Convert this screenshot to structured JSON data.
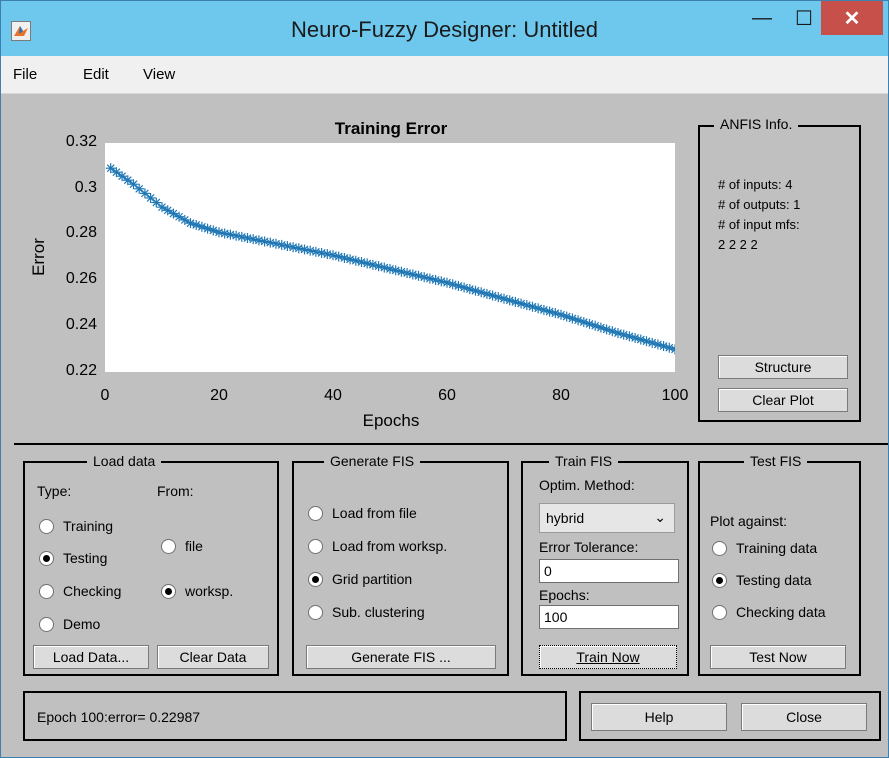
{
  "window": {
    "title": "Neuro-Fuzzy Designer: Untitled"
  },
  "titlebar": {
    "minimize_glyph": "—",
    "maximize_glyph": "☐",
    "close_glyph": "✕"
  },
  "menu": {
    "file": "File",
    "edit": "Edit",
    "view": "View"
  },
  "chart": {
    "chart_data": {
      "type": "line",
      "title": "Training Error",
      "xlabel": "Epochs",
      "ylabel": "Error",
      "xlim": [
        0,
        100
      ],
      "ylim": [
        0.22,
        0.32
      ],
      "xticks": [
        "0",
        "20",
        "40",
        "60",
        "80",
        "100"
      ],
      "yticks": [
        "0.32",
        "0.3",
        "0.28",
        "0.26",
        "0.24",
        "0.22"
      ],
      "marker": "asterisk",
      "color": "#1f77b4",
      "series": [
        {
          "x": [
            1,
            5,
            10,
            15,
            20,
            30,
            40,
            50,
            60,
            70,
            80,
            90,
            100
          ],
          "y": [
            0.309,
            0.302,
            0.292,
            0.285,
            0.281,
            0.276,
            0.271,
            0.265,
            0.259,
            0.252,
            0.245,
            0.237,
            0.2299
          ]
        }
      ]
    }
  },
  "anfis_info": {
    "title": "ANFIS Info.",
    "inputs": "# of inputs: 4",
    "outputs": "# of outputs: 1",
    "input_mfs": "# of input mfs:",
    "mfs_values": "2 2 2 2",
    "structure_btn": "Structure",
    "clear_plot_btn": "Clear Plot"
  },
  "load_data": {
    "title": "Load data",
    "type_label": "Type:",
    "from_label": "From:",
    "type_options": [
      "Training",
      "Testing",
      "Checking",
      "Demo"
    ],
    "type_selected": "Testing",
    "from_options": [
      "file",
      "worksp."
    ],
    "from_selected": "worksp.",
    "load_btn": "Load Data...",
    "clear_btn": "Clear Data"
  },
  "generate_fis": {
    "title": "Generate FIS",
    "options": [
      "Load from file",
      "Load from worksp.",
      "Grid partition",
      "Sub. clustering"
    ],
    "selected": "Grid partition",
    "button": "Generate FIS ..."
  },
  "train_fis": {
    "title": "Train FIS",
    "optim_label": "Optim. Method:",
    "method": "hybrid",
    "tolerance_label": "Error Tolerance:",
    "tolerance": "0",
    "epochs_label": "Epochs:",
    "epochs": "100",
    "button": "Train Now"
  },
  "test_fis": {
    "title": "Test FIS",
    "plot_against": "Plot against:",
    "options": [
      "Training data",
      "Testing data",
      "Checking data"
    ],
    "selected": "Testing data",
    "button": "Test Now"
  },
  "status": {
    "text": "Epoch 100:error= 0.22987"
  },
  "footer": {
    "help": "Help",
    "close": "Close"
  }
}
